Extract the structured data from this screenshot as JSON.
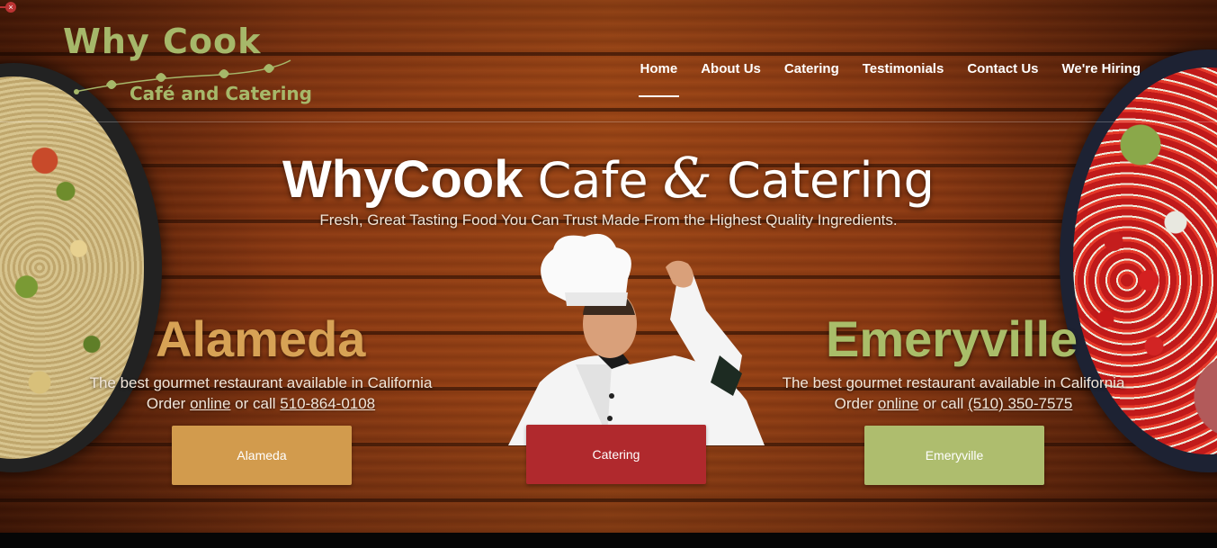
{
  "logo": {
    "line1": "Why Cook",
    "line2": "Café and Catering"
  },
  "nav": {
    "items": [
      {
        "label": "Home",
        "active": true
      },
      {
        "label": "About Us"
      },
      {
        "label": "Catering"
      },
      {
        "label": "Testimonials"
      },
      {
        "label": "Contact Us"
      },
      {
        "label": "We're Hiring"
      }
    ]
  },
  "hero": {
    "title_bold": "WhyCook",
    "title_light_1": "Cafe",
    "title_amp": "&",
    "title_light_2": "Catering",
    "subtitle": "Fresh, Great Tasting Food You Can Trust Made From the Highest Quality Ingredients."
  },
  "alameda": {
    "title": "Alameda",
    "tagline": "The best gourmet restaurant available in California",
    "order_prefix": "Order",
    "order_link": "online",
    "order_mid": "or call",
    "phone": "510-864-0108",
    "button": "Alameda"
  },
  "catering": {
    "button": "Catering"
  },
  "emeryville": {
    "title": "Emeryville",
    "tagline": "The best gourmet restaurant available in California",
    "order_prefix": "Order",
    "order_link": "online",
    "order_mid": "or call",
    "phone": "(510) 350-7575",
    "button": "Emeryville"
  },
  "colors": {
    "alameda_accent": "#d7a255",
    "emeryville_accent": "#a9bd69",
    "catering_button": "#b0292d",
    "logo_green": "#a6b86a"
  },
  "icons": {
    "close": "close-icon"
  }
}
